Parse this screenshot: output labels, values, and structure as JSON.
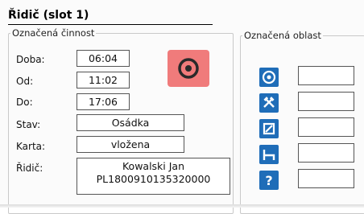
{
  "title": "Řidič (slot 1)",
  "left_group": {
    "legend": "Označená činnost",
    "rows": [
      {
        "label": "Doba:",
        "value": "06:04"
      },
      {
        "label": "Od:",
        "value": "11:02"
      },
      {
        "label": "Do:",
        "value": "17:06"
      },
      {
        "label": "Stav:",
        "value": "Osádka"
      },
      {
        "label": "Karta:",
        "value": "vložena"
      }
    ],
    "driver_label": "Řidič:",
    "driver_name": "Kowalski Jan",
    "driver_card": "PL1800910135320000",
    "target_button_icon": "target-icon",
    "target_button_color": "#f07b7b"
  },
  "right_group": {
    "legend": "Označená oblast",
    "icons": [
      "circle-target-icon",
      "hammer-cross-icon",
      "square-slash-icon",
      "bed-icon",
      "question-icon"
    ],
    "icon_color": "#1f6db8",
    "fields": [
      "",
      "",
      "",
      "",
      ""
    ]
  }
}
